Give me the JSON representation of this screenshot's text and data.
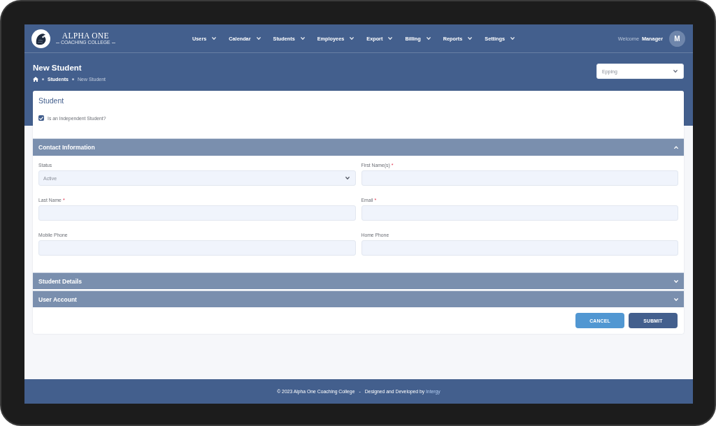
{
  "brand": {
    "name": "ALPHA ONE",
    "tagline": "COACHING COLLEGE"
  },
  "nav": [
    {
      "label": "Users"
    },
    {
      "label": "Calendar"
    },
    {
      "label": "Students"
    },
    {
      "label": "Employees"
    },
    {
      "label": "Export"
    },
    {
      "label": "Billing"
    },
    {
      "label": "Reports"
    },
    {
      "label": "Settings"
    }
  ],
  "user": {
    "greeting": "Welcome",
    "name": "Manager",
    "initial": "M"
  },
  "page": {
    "title": "New Student",
    "breadcrumb": [
      {
        "label": "Students",
        "current": false
      },
      {
        "label": "New Student",
        "current": true
      }
    ]
  },
  "branch_select": {
    "value": "Epping"
  },
  "student_card": {
    "title": "Student",
    "checkbox": {
      "label": "Is an Independent Student?",
      "checked": true
    }
  },
  "sections": [
    {
      "title": "Contact Information",
      "expanded": true,
      "fields": [
        {
          "label": "Status",
          "kind": "select",
          "value": "Active"
        },
        {
          "label": "First Name(s)",
          "kind": "text",
          "required_mark": "*"
        },
        {
          "label": "Last Name",
          "kind": "text",
          "required_mark": "*"
        },
        {
          "label": "Email",
          "kind": "text",
          "required_mark": "*"
        },
        {
          "label": "Mobile Phone",
          "kind": "text"
        },
        {
          "label": "Home Phone",
          "kind": "text"
        }
      ]
    },
    {
      "title": "Student Details",
      "expanded": false
    },
    {
      "title": "User Account",
      "expanded": false
    }
  ],
  "buttons": [
    {
      "label": "CANCEL",
      "kind": "secondary"
    },
    {
      "label": "SUBMIT",
      "kind": "primary"
    }
  ],
  "footer": {
    "copyright": "© 2023 Alpha One Coaching College",
    "separator": "-",
    "credit": "Designed and Developed by",
    "link": "Intergy"
  }
}
